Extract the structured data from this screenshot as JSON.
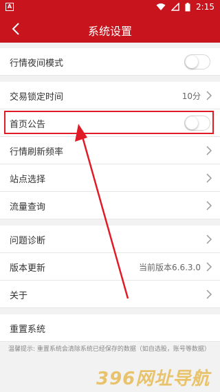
{
  "status_bar": {
    "time": "2:15",
    "app_badge": "A"
  },
  "header": {
    "title": "系统设置"
  },
  "settings": {
    "night_mode": {
      "label": "行情夜间模式",
      "enabled": false
    },
    "lock_time": {
      "label": "交易锁定时间",
      "value": "10分"
    },
    "home_notice": {
      "label": "首页公告",
      "enabled": false
    },
    "refresh_rate": {
      "label": "行情刷新频率"
    },
    "site_select": {
      "label": "站点选择"
    },
    "traffic": {
      "label": "流量查询"
    },
    "diagnosis": {
      "label": "问题诊断"
    },
    "version": {
      "label": "版本更新",
      "value": "当前版本6.6.3.0"
    },
    "about": {
      "label": "关于"
    },
    "reset": {
      "label": "重置系统"
    }
  },
  "hint": "温馨提示: 重置系统会清除系统已经保存的数据（如自选股，账号等数据）",
  "watermark": "396网址导航",
  "colors": {
    "brand_red": "#c8151d",
    "highlight": "#e01b25"
  }
}
